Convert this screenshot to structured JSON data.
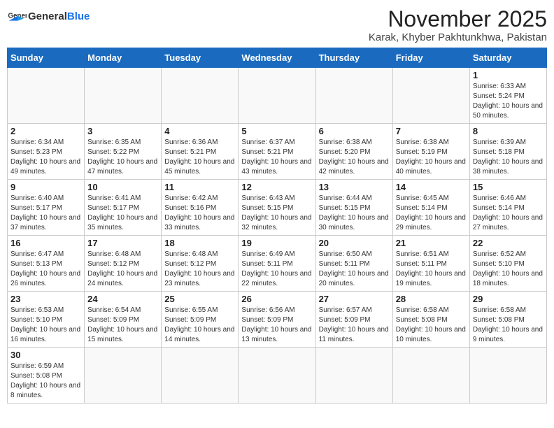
{
  "logo": {
    "text_general": "General",
    "text_blue": "Blue"
  },
  "header": {
    "month": "November 2025",
    "location": "Karak, Khyber Pakhtunkhwa, Pakistan"
  },
  "weekdays": [
    "Sunday",
    "Monday",
    "Tuesday",
    "Wednesday",
    "Thursday",
    "Friday",
    "Saturday"
  ],
  "weeks": [
    [
      {
        "day": "",
        "info": ""
      },
      {
        "day": "",
        "info": ""
      },
      {
        "day": "",
        "info": ""
      },
      {
        "day": "",
        "info": ""
      },
      {
        "day": "",
        "info": ""
      },
      {
        "day": "",
        "info": ""
      },
      {
        "day": "1",
        "info": "Sunrise: 6:33 AM\nSunset: 5:24 PM\nDaylight: 10 hours and 50 minutes."
      }
    ],
    [
      {
        "day": "2",
        "info": "Sunrise: 6:34 AM\nSunset: 5:23 PM\nDaylight: 10 hours and 49 minutes."
      },
      {
        "day": "3",
        "info": "Sunrise: 6:35 AM\nSunset: 5:22 PM\nDaylight: 10 hours and 47 minutes."
      },
      {
        "day": "4",
        "info": "Sunrise: 6:36 AM\nSunset: 5:21 PM\nDaylight: 10 hours and 45 minutes."
      },
      {
        "day": "5",
        "info": "Sunrise: 6:37 AM\nSunset: 5:21 PM\nDaylight: 10 hours and 43 minutes."
      },
      {
        "day": "6",
        "info": "Sunrise: 6:38 AM\nSunset: 5:20 PM\nDaylight: 10 hours and 42 minutes."
      },
      {
        "day": "7",
        "info": "Sunrise: 6:38 AM\nSunset: 5:19 PM\nDaylight: 10 hours and 40 minutes."
      },
      {
        "day": "8",
        "info": "Sunrise: 6:39 AM\nSunset: 5:18 PM\nDaylight: 10 hours and 38 minutes."
      }
    ],
    [
      {
        "day": "9",
        "info": "Sunrise: 6:40 AM\nSunset: 5:17 PM\nDaylight: 10 hours and 37 minutes."
      },
      {
        "day": "10",
        "info": "Sunrise: 6:41 AM\nSunset: 5:17 PM\nDaylight: 10 hours and 35 minutes."
      },
      {
        "day": "11",
        "info": "Sunrise: 6:42 AM\nSunset: 5:16 PM\nDaylight: 10 hours and 33 minutes."
      },
      {
        "day": "12",
        "info": "Sunrise: 6:43 AM\nSunset: 5:15 PM\nDaylight: 10 hours and 32 minutes."
      },
      {
        "day": "13",
        "info": "Sunrise: 6:44 AM\nSunset: 5:15 PM\nDaylight: 10 hours and 30 minutes."
      },
      {
        "day": "14",
        "info": "Sunrise: 6:45 AM\nSunset: 5:14 PM\nDaylight: 10 hours and 29 minutes."
      },
      {
        "day": "15",
        "info": "Sunrise: 6:46 AM\nSunset: 5:14 PM\nDaylight: 10 hours and 27 minutes."
      }
    ],
    [
      {
        "day": "16",
        "info": "Sunrise: 6:47 AM\nSunset: 5:13 PM\nDaylight: 10 hours and 26 minutes."
      },
      {
        "day": "17",
        "info": "Sunrise: 6:48 AM\nSunset: 5:12 PM\nDaylight: 10 hours and 24 minutes."
      },
      {
        "day": "18",
        "info": "Sunrise: 6:48 AM\nSunset: 5:12 PM\nDaylight: 10 hours and 23 minutes."
      },
      {
        "day": "19",
        "info": "Sunrise: 6:49 AM\nSunset: 5:11 PM\nDaylight: 10 hours and 22 minutes."
      },
      {
        "day": "20",
        "info": "Sunrise: 6:50 AM\nSunset: 5:11 PM\nDaylight: 10 hours and 20 minutes."
      },
      {
        "day": "21",
        "info": "Sunrise: 6:51 AM\nSunset: 5:11 PM\nDaylight: 10 hours and 19 minutes."
      },
      {
        "day": "22",
        "info": "Sunrise: 6:52 AM\nSunset: 5:10 PM\nDaylight: 10 hours and 18 minutes."
      }
    ],
    [
      {
        "day": "23",
        "info": "Sunrise: 6:53 AM\nSunset: 5:10 PM\nDaylight: 10 hours and 16 minutes."
      },
      {
        "day": "24",
        "info": "Sunrise: 6:54 AM\nSunset: 5:09 PM\nDaylight: 10 hours and 15 minutes."
      },
      {
        "day": "25",
        "info": "Sunrise: 6:55 AM\nSunset: 5:09 PM\nDaylight: 10 hours and 14 minutes."
      },
      {
        "day": "26",
        "info": "Sunrise: 6:56 AM\nSunset: 5:09 PM\nDaylight: 10 hours and 13 minutes."
      },
      {
        "day": "27",
        "info": "Sunrise: 6:57 AM\nSunset: 5:09 PM\nDaylight: 10 hours and 11 minutes."
      },
      {
        "day": "28",
        "info": "Sunrise: 6:58 AM\nSunset: 5:08 PM\nDaylight: 10 hours and 10 minutes."
      },
      {
        "day": "29",
        "info": "Sunrise: 6:58 AM\nSunset: 5:08 PM\nDaylight: 10 hours and 9 minutes."
      }
    ],
    [
      {
        "day": "30",
        "info": "Sunrise: 6:59 AM\nSunset: 5:08 PM\nDaylight: 10 hours and 8 minutes."
      },
      {
        "day": "",
        "info": ""
      },
      {
        "day": "",
        "info": ""
      },
      {
        "day": "",
        "info": ""
      },
      {
        "day": "",
        "info": ""
      },
      {
        "day": "",
        "info": ""
      },
      {
        "day": "",
        "info": ""
      }
    ]
  ]
}
